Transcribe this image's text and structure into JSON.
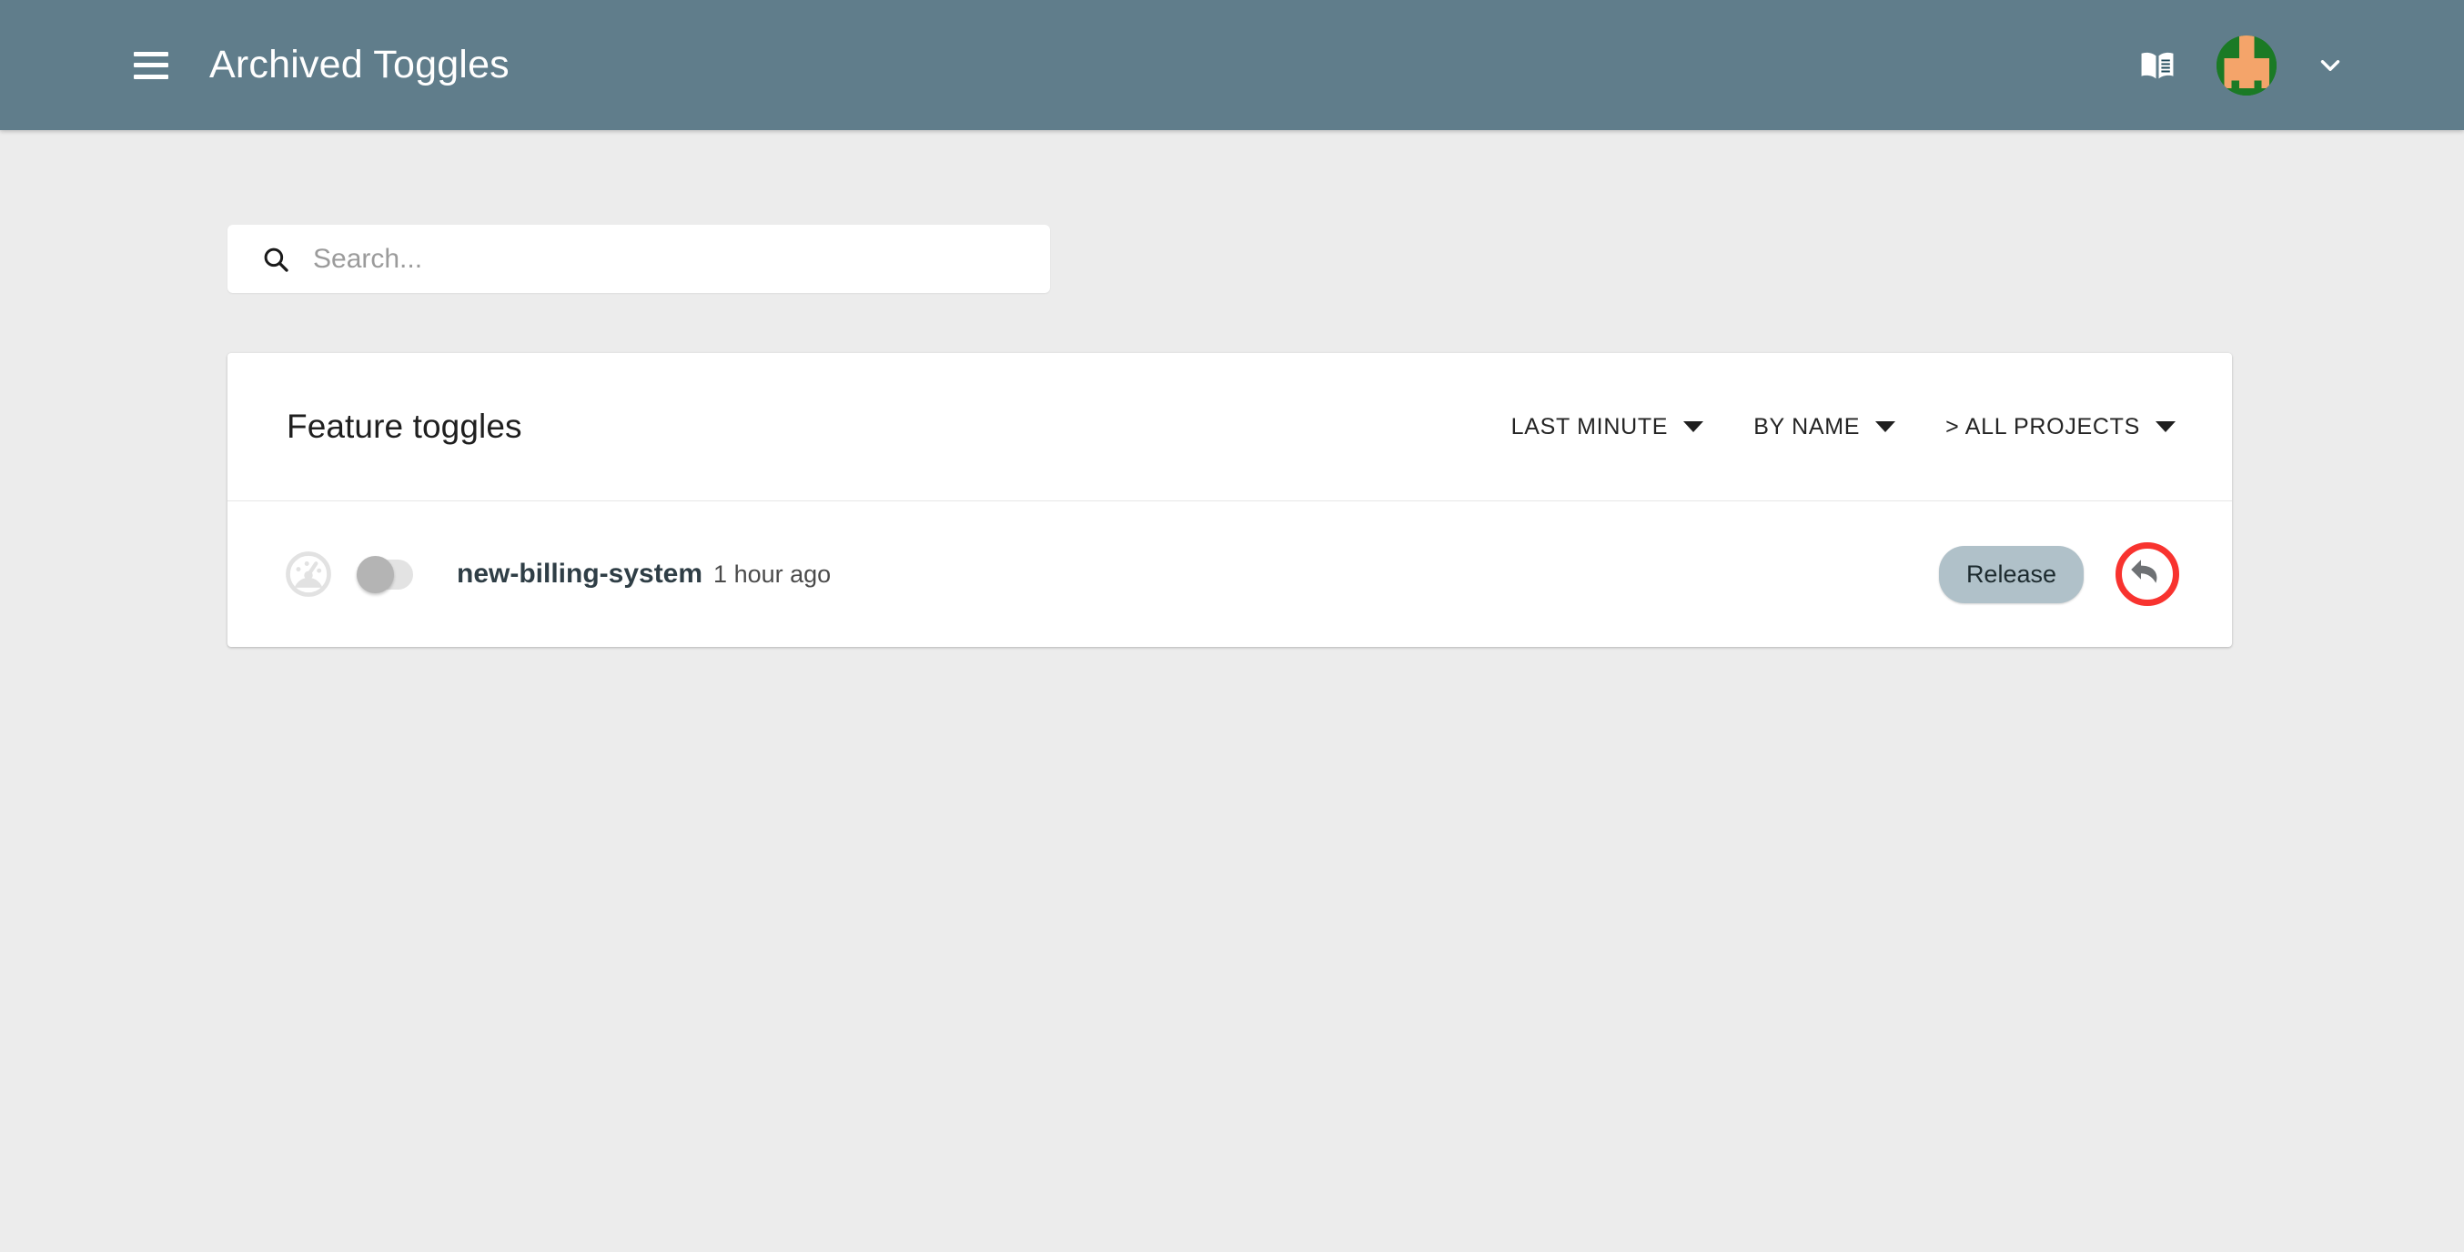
{
  "appbar": {
    "menu_icon": "hamburger-menu-icon",
    "title": "Archived Toggles",
    "docs_icon": "book-icon",
    "avatar_icon": "user-avatar",
    "account_caret_icon": "chevron-down-icon",
    "background_color": "#607d8b"
  },
  "search": {
    "icon": "search-icon",
    "value": "",
    "placeholder": "Search..."
  },
  "card": {
    "title": "Feature toggles",
    "filters": [
      {
        "label": "LAST MINUTE",
        "caret_icon": "caret-down-icon"
      },
      {
        "label": "BY NAME",
        "caret_icon": "caret-down-icon"
      },
      {
        "label": "> ALL PROJECTS",
        "caret_icon": "caret-down-icon"
      }
    ],
    "rows": [
      {
        "metrics_icon": "gauge-icon",
        "enabled_toggle_icon": "toggle-switch-off",
        "name": "new-billing-system",
        "time": "1 hour ago",
        "chip_label": "Release",
        "revert_icon": "undo-arrow-icon"
      }
    ]
  },
  "annotation": {
    "type": "highlight-ring",
    "color": "#f8332f",
    "target": "revert-button"
  },
  "page": {
    "background_color": "#ececec"
  }
}
